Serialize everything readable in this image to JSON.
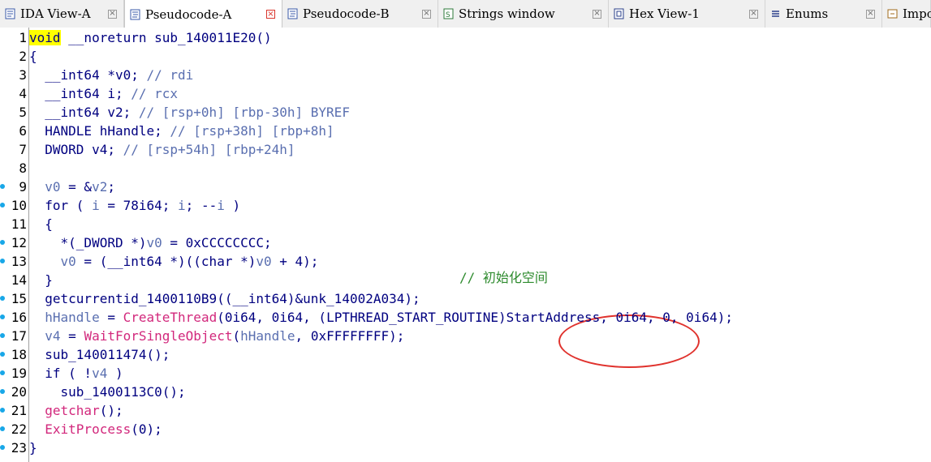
{
  "tabs": [
    {
      "label": "IDA View-A",
      "icon": "ida-view-icon",
      "active": false
    },
    {
      "label": "Pseudocode-A",
      "icon": "pseudocode-icon",
      "active": true
    },
    {
      "label": "Pseudocode-B",
      "icon": "pseudocode-icon",
      "active": false
    },
    {
      "label": "Strings window",
      "icon": "strings-icon",
      "active": false
    },
    {
      "label": "Hex View-1",
      "icon": "hex-view-icon",
      "active": false
    },
    {
      "label": "Enums",
      "icon": "enums-icon",
      "active": false
    },
    {
      "label": "Impo",
      "icon": "imports-icon",
      "active": false
    }
  ],
  "close_glyph": "×",
  "code": {
    "line_numbers": [
      "1",
      "2",
      "3",
      "4",
      "5",
      "6",
      "7",
      "8",
      "9",
      "10",
      "11",
      "12",
      "13",
      "14",
      "15",
      "16",
      "17",
      "18",
      "19",
      "20",
      "21",
      "22",
      "23"
    ],
    "breakpoint_lines": [
      9,
      10,
      12,
      13,
      15,
      16,
      17,
      18,
      19,
      20,
      21,
      22,
      23
    ],
    "lines": [
      [
        {
          "t": "void",
          "c": "kw hl"
        },
        {
          "t": " __noreturn sub_140011E20()",
          "c": "plain"
        }
      ],
      [
        {
          "t": "{",
          "c": "plain"
        }
      ],
      [
        {
          "t": "  __int64 *v0; ",
          "c": "plain"
        },
        {
          "t": "// rdi",
          "c": "cm"
        }
      ],
      [
        {
          "t": "  __int64 i; ",
          "c": "plain"
        },
        {
          "t": "// rcx",
          "c": "cm"
        }
      ],
      [
        {
          "t": "  __int64 v2; ",
          "c": "plain"
        },
        {
          "t": "// [rsp+0h] [rbp-30h] BYREF",
          "c": "cm"
        }
      ],
      [
        {
          "t": "  HANDLE hHandle; ",
          "c": "plain"
        },
        {
          "t": "// [rsp+38h] [rbp+8h]",
          "c": "cm"
        }
      ],
      [
        {
          "t": "  DWORD v4; ",
          "c": "plain"
        },
        {
          "t": "// [rsp+54h] [rbp+24h]",
          "c": "cm"
        }
      ],
      [],
      [
        {
          "t": "  v0",
          "c": "var"
        },
        {
          "t": " = &",
          "c": "plain"
        },
        {
          "t": "v2",
          "c": "var"
        },
        {
          "t": ";",
          "c": "plain"
        }
      ],
      [
        {
          "t": "  for ( ",
          "c": "plain"
        },
        {
          "t": "i",
          "c": "var"
        },
        {
          "t": " = 78i64; ",
          "c": "plain"
        },
        {
          "t": "i",
          "c": "var"
        },
        {
          "t": "; --",
          "c": "plain"
        },
        {
          "t": "i",
          "c": "var"
        },
        {
          "t": " )",
          "c": "plain"
        }
      ],
      [
        {
          "t": "  {",
          "c": "plain"
        }
      ],
      [
        {
          "t": "    *(_DWORD *)",
          "c": "plain"
        },
        {
          "t": "v0",
          "c": "var"
        },
        {
          "t": " = 0xCCCCCCCC;",
          "c": "plain"
        }
      ],
      [
        {
          "t": "    v0",
          "c": "var"
        },
        {
          "t": " = (__int64 *)((char *)",
          "c": "plain"
        },
        {
          "t": "v0",
          "c": "var"
        },
        {
          "t": " + 4);",
          "c": "plain"
        }
      ],
      [
        {
          "t": "  }",
          "c": "plain"
        }
      ],
      [
        {
          "t": "  getcurrentid_1400110B9((__int64)&unk_14002A034);",
          "c": "plain"
        }
      ],
      [
        {
          "t": "  hHandle",
          "c": "var"
        },
        {
          "t": " = ",
          "c": "plain"
        },
        {
          "t": "CreateThread",
          "c": "fn"
        },
        {
          "t": "(0i64, 0i64, (LPTHREAD_START_ROUTINE)StartAddress, 0i64, 0, 0i64);",
          "c": "plain"
        }
      ],
      [
        {
          "t": "  v4",
          "c": "var"
        },
        {
          "t": " = ",
          "c": "plain"
        },
        {
          "t": "WaitForSingleObject",
          "c": "fn"
        },
        {
          "t": "(",
          "c": "plain"
        },
        {
          "t": "hHandle",
          "c": "var"
        },
        {
          "t": ", 0xFFFFFFFF);",
          "c": "plain"
        }
      ],
      [
        {
          "t": "  sub_140011474();",
          "c": "plain"
        }
      ],
      [
        {
          "t": "  if ( !",
          "c": "plain"
        },
        {
          "t": "v4",
          "c": "var"
        },
        {
          "t": " )",
          "c": "plain"
        }
      ],
      [
        {
          "t": "    sub_1400113C0();",
          "c": "plain"
        }
      ],
      [
        {
          "t": "  ",
          "c": "plain"
        },
        {
          "t": "getchar",
          "c": "fn"
        },
        {
          "t": "();",
          "c": "plain"
        }
      ],
      [
        {
          "t": "  ",
          "c": "plain"
        },
        {
          "t": "ExitProcess",
          "c": "fn"
        },
        {
          "t": "(0);",
          "c": "plain"
        }
      ],
      [
        {
          "t": "}",
          "c": "plain"
        }
      ]
    ],
    "annotation_comment": "// 初始化空间"
  },
  "colors": {
    "keyword": "#000080",
    "comment": "#5a6fb0",
    "function": "#d2287c",
    "chinese_comment": "#2e8b2e",
    "highlight": "#ffff00",
    "annotation_circle": "#e0322d",
    "breakpoint_dot": "#18a7e8"
  }
}
